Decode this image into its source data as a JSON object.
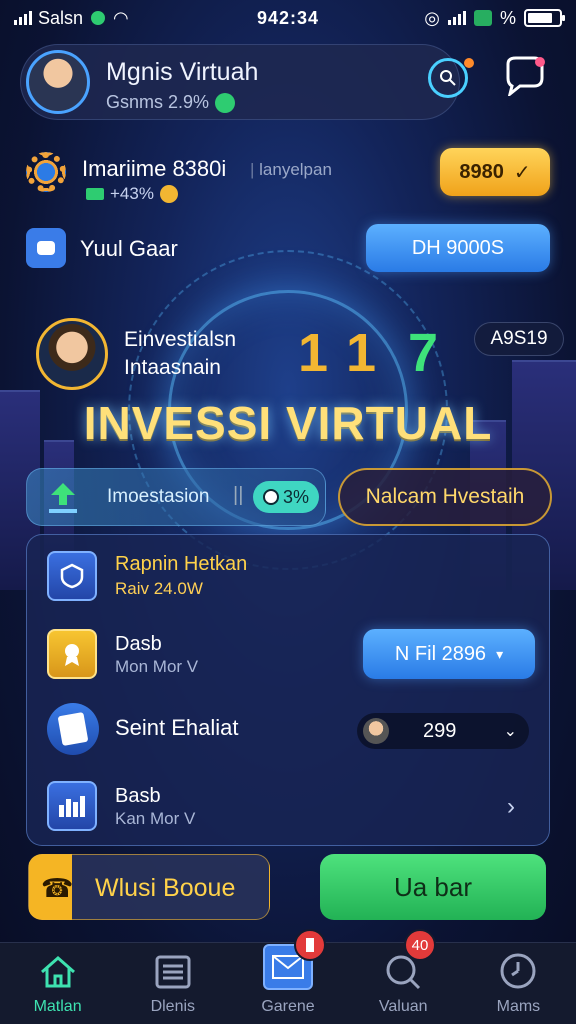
{
  "status_bar": {
    "carrier": "Salsn",
    "time": "942:34",
    "battery_label": "%"
  },
  "profile": {
    "name": "Mgnis Virtuah",
    "subtitle": "Gsnms 2.9%"
  },
  "row1": {
    "title": "Imariime 8380i",
    "sep_label": "lanyelpan",
    "sub": "+43%",
    "button": "8980"
  },
  "row2": {
    "title": "Yuul Gaar",
    "button": "DH 9000S"
  },
  "hero": {
    "label_line1": "Einvestialsn",
    "label_line2": "Intaasnain",
    "num1": "1",
    "num2": "1",
    "num3": "7",
    "badge": "A9S19",
    "title": "INVESSI VIRTUAL"
  },
  "invest": {
    "left_label": "Imoestasion",
    "percent": "3%",
    "right_label": "Nalcam Hvestaih"
  },
  "panel": {
    "items": [
      {
        "title": "Rapnin Hetkan",
        "sub": "Raiv 24.0W"
      },
      {
        "title": "Dasb",
        "sub": "Mon Mor V",
        "select": "N Fil 2896"
      },
      {
        "title": "Seint Ehaliat",
        "value": "299"
      },
      {
        "title": "Basb",
        "sub": "Kan Mor V"
      }
    ]
  },
  "buttons": {
    "left": "Wlusi Booue",
    "right": "Ua bar"
  },
  "tabs": [
    {
      "label": "Matlan"
    },
    {
      "label": "Dlenis"
    },
    {
      "label": "Garene",
      "badge": ""
    },
    {
      "label": "Valuan",
      "badge": "40"
    },
    {
      "label": "Mams"
    }
  ],
  "colors": {
    "accent_gold": "#f2b632",
    "accent_blue": "#2a7be6",
    "accent_green": "#22b255",
    "active_tab": "#3ee2b0"
  }
}
